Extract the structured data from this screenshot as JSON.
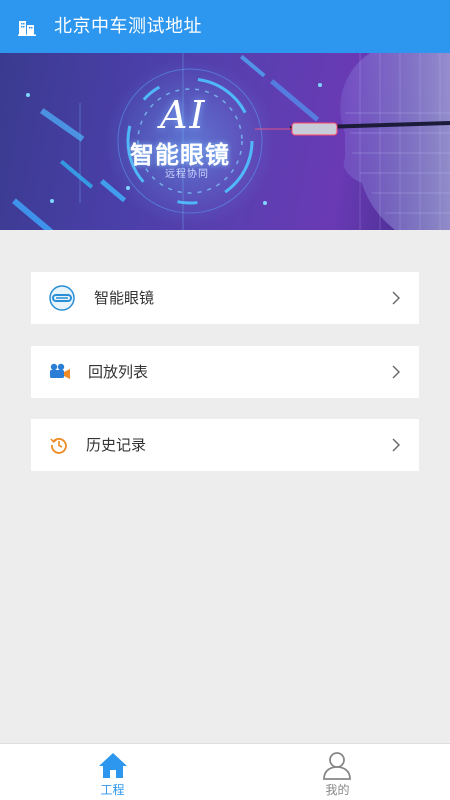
{
  "header": {
    "title": "北京中车测试地址",
    "icon": "building-icon",
    "background": "#2d96ef"
  },
  "banner": {
    "ai_text": "AI",
    "title": "智能眼镜",
    "subtitle": "远程协同"
  },
  "menu": [
    {
      "label": "智能眼镜",
      "icon": "glasses-icon",
      "icon_color": "#2a8fd6"
    },
    {
      "label": "回放列表",
      "icon": "video-camera-icon",
      "icon_color": "#2a7ed6"
    },
    {
      "label": "历史记录",
      "icon": "history-icon",
      "icon_color": "#f08a24"
    }
  ],
  "bottom_nav": {
    "items": [
      {
        "label": "工程",
        "icon": "home-icon",
        "active": true
      },
      {
        "label": "我的",
        "icon": "user-icon",
        "active": false
      }
    ],
    "active_color": "#2d96ef",
    "inactive_color": "#888888"
  }
}
